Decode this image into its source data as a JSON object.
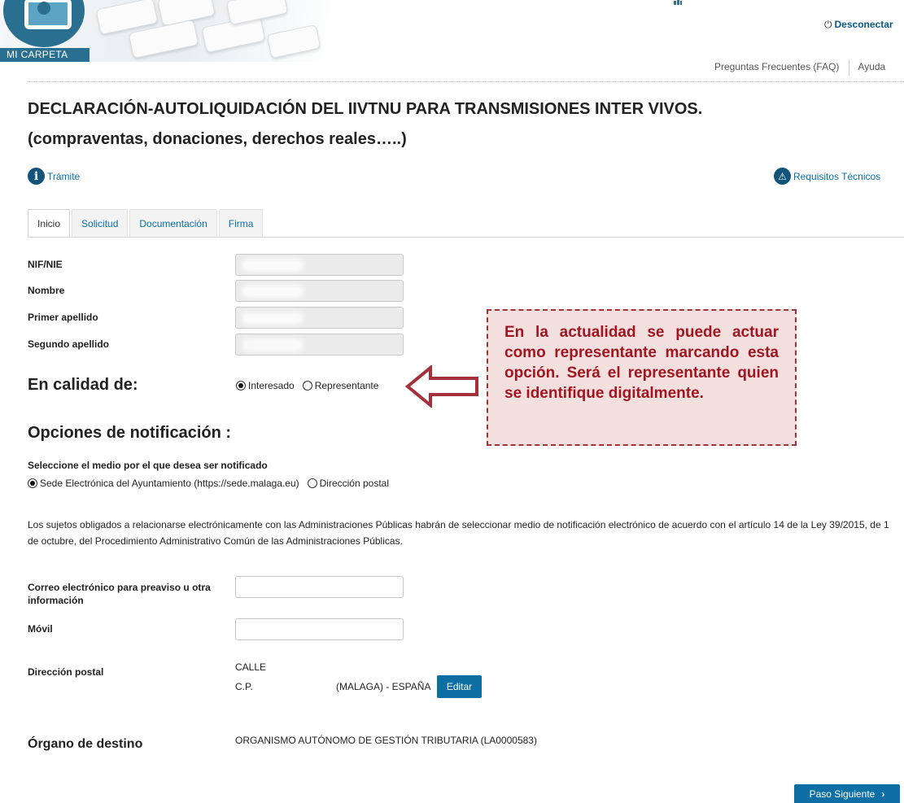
{
  "header": {
    "logo_label": "MI CARPETA",
    "logout_label": "Desconectar",
    "faq_link": "Preguntas Frecuentes (FAQ)",
    "help_link": "Ayuda"
  },
  "page": {
    "title": "DECLARACIÓN-AUTOLIQUIDACIÓN DEL IIVTNU PARA TRANSMISIONES INTER VIVOS.",
    "subtitle": "(compraventas, donaciones, derechos reales…..)",
    "tramite_link": "Trámite",
    "requisitos_link": "Requisitos Técnicos"
  },
  "tabs": [
    {
      "label": "Inicio",
      "active": true
    },
    {
      "label": "Solicitud",
      "active": false
    },
    {
      "label": "Documentación",
      "active": false
    },
    {
      "label": "Firma",
      "active": false
    }
  ],
  "identity": {
    "nif_label": "NIF/NIE",
    "nombre_label": "Nombre",
    "apellido1_label": "Primer apellido",
    "apellido2_label": "Segundo apellido"
  },
  "calidad": {
    "heading": "En calidad de:",
    "option_interesado": "Interesado",
    "option_representante": "Representante",
    "selected": "Interesado"
  },
  "callout": {
    "text": "En la actualidad se puede actuar como representante marcando esta opción. Será el representante quien se identifique digitalmente."
  },
  "notificacion": {
    "heading": "Opciones de notificación :",
    "prompt": "Seleccione el medio por el que desea ser notificado",
    "option_sede": "Sede Electrónica del Ayuntamiento (https://sede.malaga.eu)",
    "option_postal": "Dirección postal",
    "selected": "Sede Electrónica del Ayuntamiento (https://sede.malaga.eu)",
    "legal_text": "Los sujetos obligados a relacionarse electrónicamente con las Administraciones Públicas habrán de seleccionar medio de notificación electrónico de acuerdo con el artículo 14 de la Ley 39/2015, de 1 de octubre, del Procedimiento Administrativo Común de las Administraciones Públicas."
  },
  "contact": {
    "email_label": "Correo electrónico para preaviso u otra información",
    "email_value": "",
    "movil_label": "Móvil",
    "movil_value": "",
    "direccion_label": "Dirección postal",
    "direccion_line1": "CALLE",
    "direccion_cp": "C.P.",
    "direccion_region": "(MALAGA) - ESPAÑA",
    "edit_button": "Editar"
  },
  "organo": {
    "label": "Órgano de destino",
    "value": "ORGANISMO AUTÓNOMO DE GESTIÓN TRIBUTARIA (LA0000583)"
  },
  "footer": {
    "next_button": "Paso Siguiente"
  },
  "colors": {
    "accent": "#0d6fa3",
    "callout_text": "#a11620",
    "callout_border": "#a3303a",
    "callout_bg": "#f4dfdf"
  }
}
